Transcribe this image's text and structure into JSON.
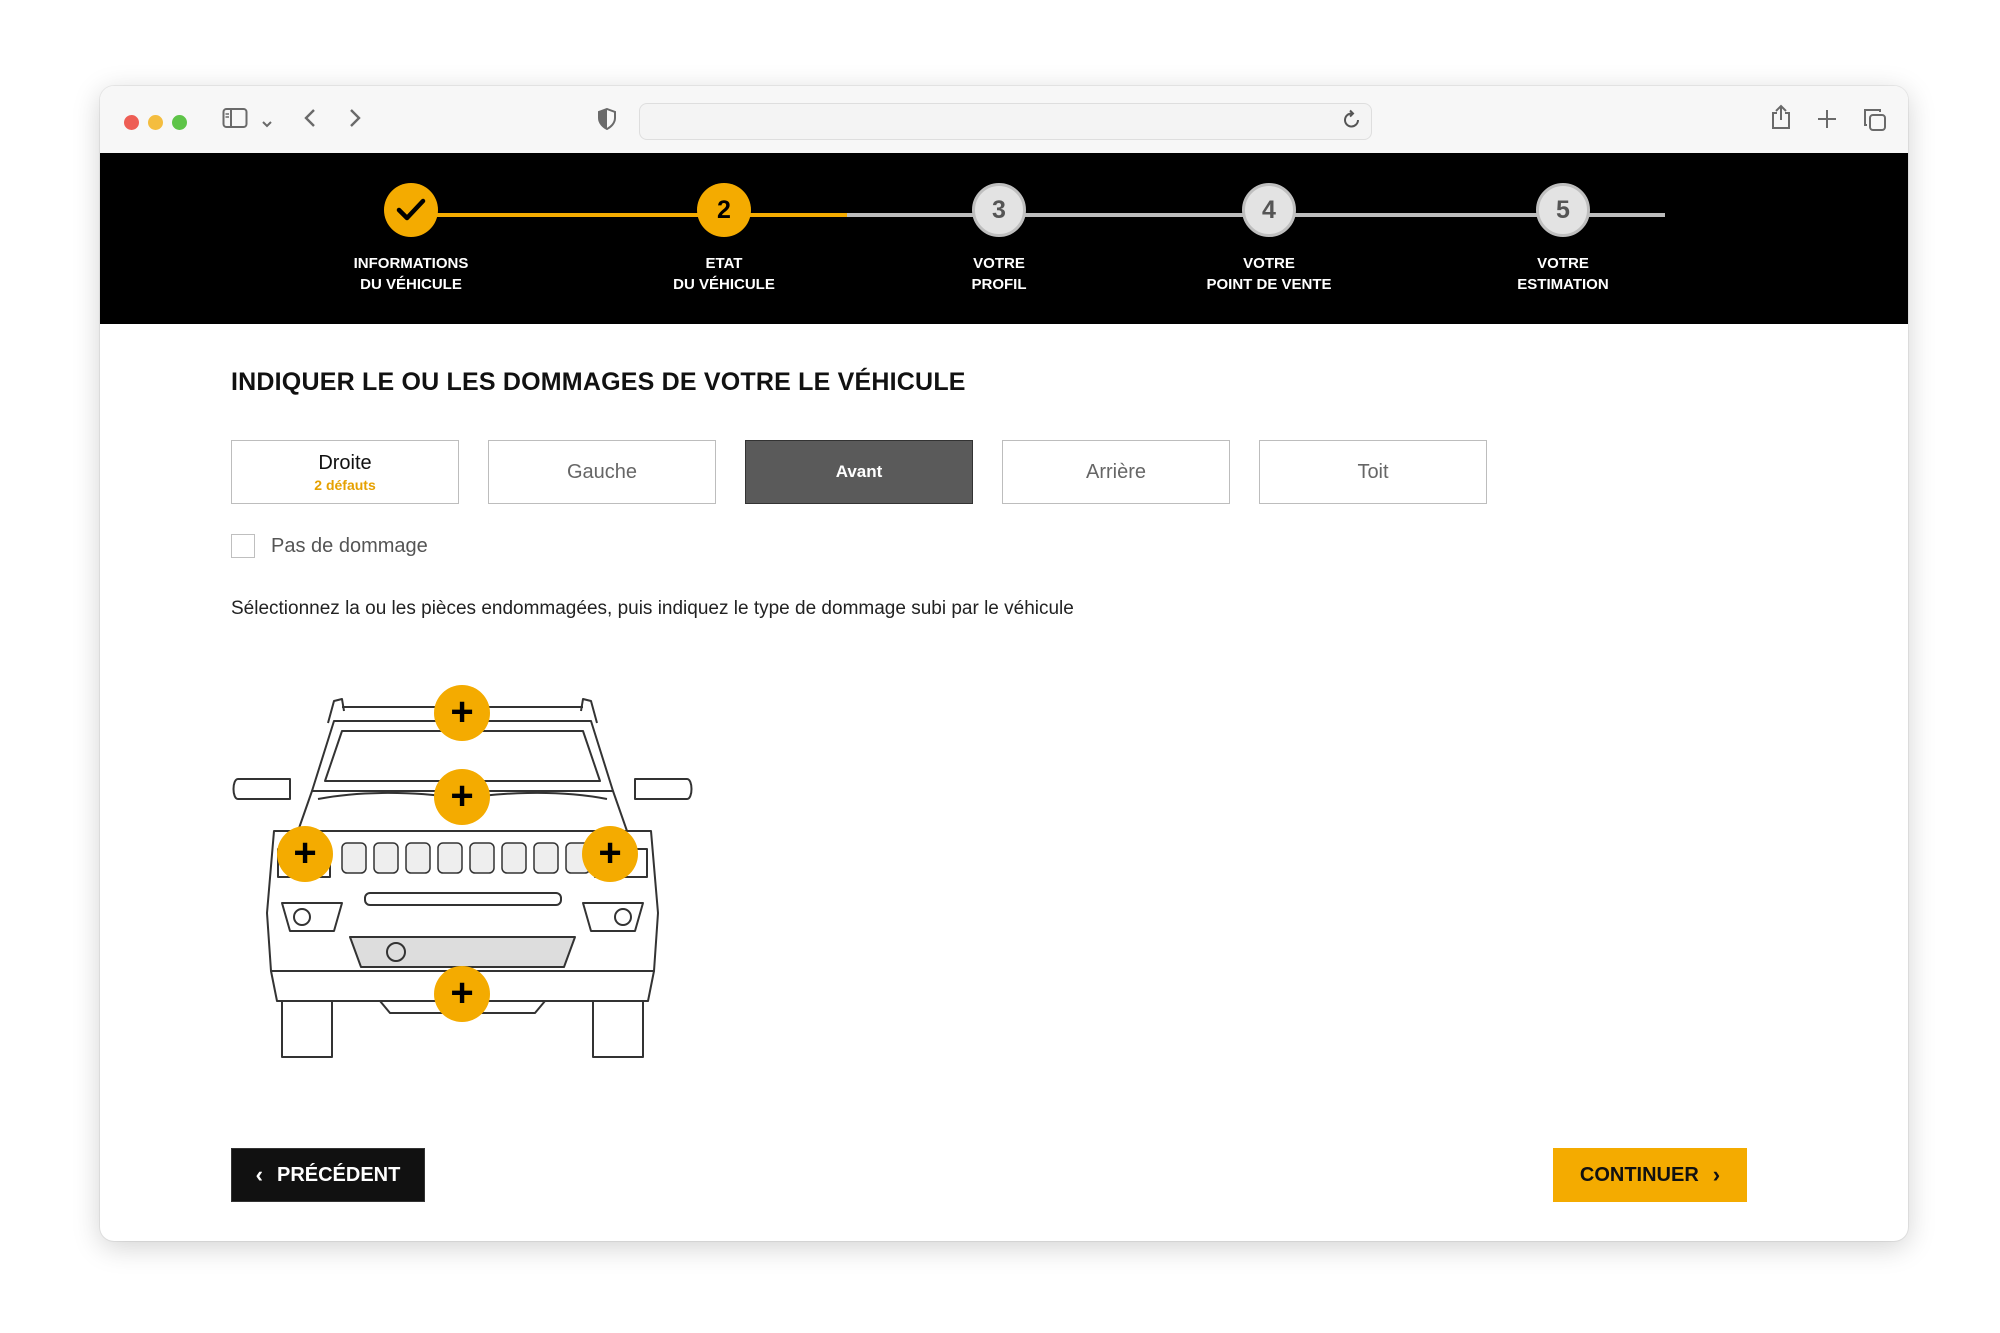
{
  "browser": {
    "url": ""
  },
  "stepper": {
    "steps": [
      {
        "number": "",
        "label": "INFORMATIONS\nDU VÉHICULE",
        "state": "done"
      },
      {
        "number": "2",
        "label": "ETAT\nDU VÉHICULE",
        "state": "current"
      },
      {
        "number": "3",
        "label": "VOTRE\nPROFIL",
        "state": "todo"
      },
      {
        "number": "4",
        "label": "VOTRE\nPOINT DE VENTE",
        "state": "todo"
      },
      {
        "number": "5",
        "label": "VOTRE\nESTIMATION",
        "state": "todo"
      }
    ],
    "progress_percent": 42,
    "colors": {
      "accent": "#f4ab00",
      "track_inactive": "#bdbdbd",
      "bar": "#000000"
    }
  },
  "main": {
    "title": "INDIQUER LE OU LES DOMMAGES DE VOTRE LE VÉHICULE",
    "tabs": [
      {
        "label": "Droite",
        "sub": "2 défauts",
        "selected": false
      },
      {
        "label": "Gauche",
        "sub": "",
        "selected": false
      },
      {
        "label": "Avant",
        "sub": "",
        "selected": true
      },
      {
        "label": "Arrière",
        "sub": "",
        "selected": false
      },
      {
        "label": "Toit",
        "sub": "",
        "selected": false
      }
    ],
    "no_damage_label": "Pas de dommage",
    "no_damage_checked": false,
    "instruction": "Sélectionnez la ou les pièces endommagées, puis indiquez le type de dommage subi par le véhicule",
    "hotspot_symbol": "+",
    "vehicle_view": "front",
    "hotspot_count": 5
  },
  "footer": {
    "prev_label": "PRÉCÉDENT",
    "next_label": "CONTINUER"
  },
  "icons": {
    "check": "✓",
    "chevron_left": "‹",
    "chevron_right": "›"
  }
}
